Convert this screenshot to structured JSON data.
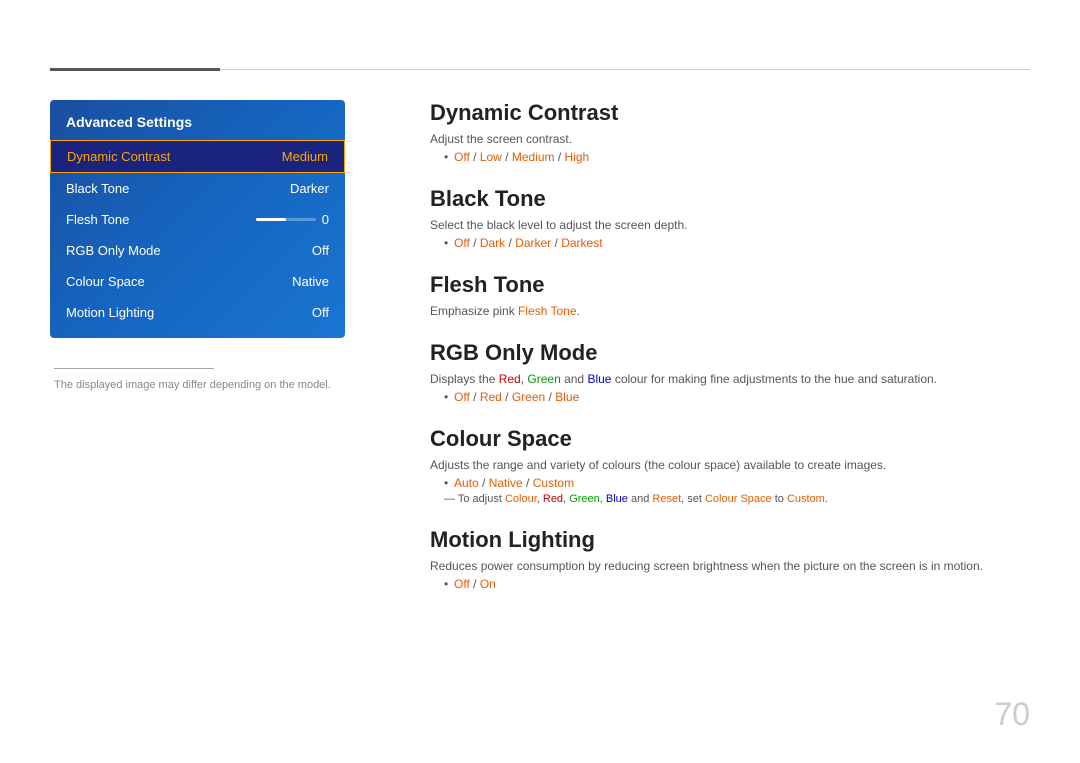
{
  "topLine": {},
  "leftPanel": {
    "title": "Advanced Settings",
    "items": [
      {
        "label": "Dynamic Contrast",
        "value": "Medium",
        "active": true
      },
      {
        "label": "Black Tone",
        "value": "Darker",
        "active": false
      },
      {
        "label": "Flesh Tone",
        "value": "0",
        "slider": true,
        "active": false
      },
      {
        "label": "RGB Only Mode",
        "value": "Off",
        "active": false
      },
      {
        "label": "Colour Space",
        "value": "Native",
        "active": false
      },
      {
        "label": "Motion Lighting",
        "value": "Off",
        "active": false
      }
    ],
    "note": "The displayed image may differ depending on the model."
  },
  "mainContent": {
    "sections": [
      {
        "id": "dynamic-contrast",
        "title": "Dynamic Contrast",
        "desc": "Adjust the screen contrast.",
        "options_plain": "Off / Low / Medium / High",
        "options_highlights": [
          {
            "text": "Off",
            "color": "orange"
          },
          {
            "text": " / ",
            "color": "plain"
          },
          {
            "text": "Low",
            "color": "orange"
          },
          {
            "text": " / ",
            "color": "plain"
          },
          {
            "text": "Medium",
            "color": "orange"
          },
          {
            "text": " / ",
            "color": "plain"
          },
          {
            "text": "High",
            "color": "orange"
          }
        ]
      },
      {
        "id": "black-tone",
        "title": "Black Tone",
        "desc": "Select the black level to adjust the screen depth.",
        "options_plain": "Off / Dark / Darker / Darkest"
      },
      {
        "id": "flesh-tone",
        "title": "Flesh Tone",
        "desc": "Emphasize pink Flesh Tone."
      },
      {
        "id": "rgb-only-mode",
        "title": "RGB Only Mode",
        "desc": "Displays the Red, Green and Blue colour for making fine adjustments to the hue and saturation.",
        "options_plain": "Off / Red / Green / Blue"
      },
      {
        "id": "colour-space",
        "title": "Colour Space",
        "desc": "Adjusts the range and variety of colours (the colour space) available to create images.",
        "options_plain": "Auto / Native / Custom",
        "subnote": "To adjust Colour, Red, Green, Blue and Reset, set Colour Space to Custom."
      },
      {
        "id": "motion-lighting",
        "title": "Motion Lighting",
        "desc": "Reduces power consumption by reducing screen brightness when the picture on the screen is in motion.",
        "options_plain": "Off / On"
      }
    ]
  },
  "pageNumber": "70"
}
